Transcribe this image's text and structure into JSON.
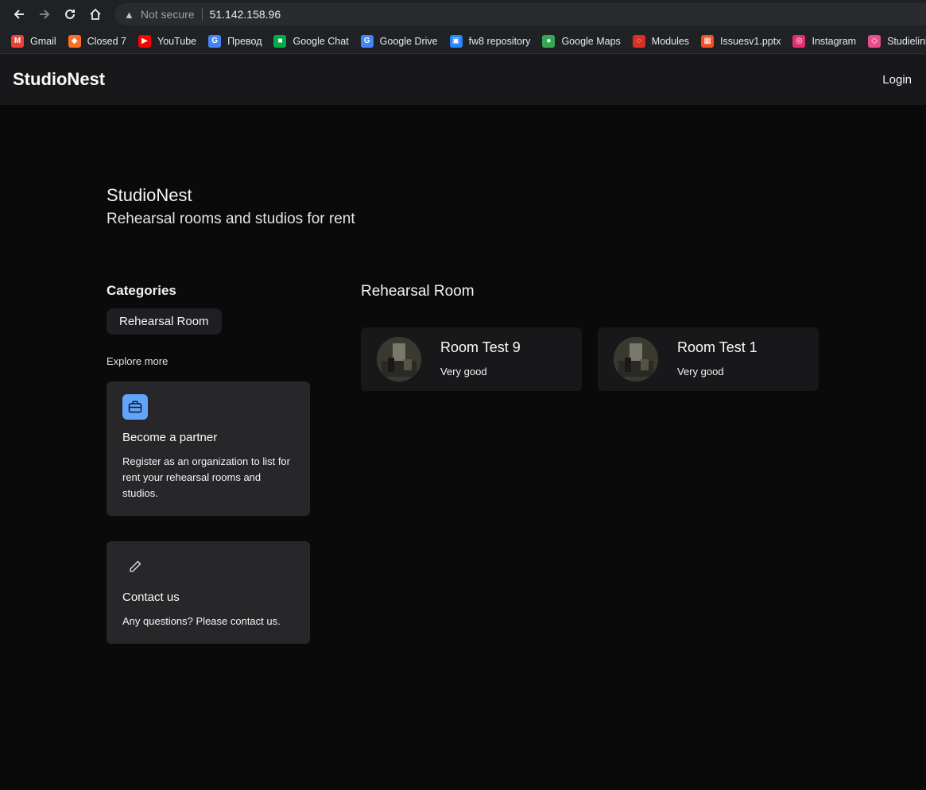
{
  "browser": {
    "not_secure": "Not secure",
    "url": "51.142.158.96",
    "bookmarks": [
      {
        "label": "Gmail",
        "icon": "gmail-icon",
        "color": "#ea4335"
      },
      {
        "label": "Closed 7",
        "icon": "gitlab-icon",
        "color": "#fc6d26"
      },
      {
        "label": "YouTube",
        "icon": "youtube-icon",
        "color": "#ff0000"
      },
      {
        "label": "Превод",
        "icon": "translate-icon",
        "color": "#4285f4"
      },
      {
        "label": "Google Chat",
        "icon": "chat-icon",
        "color": "#00ac47"
      },
      {
        "label": "Google Drive",
        "icon": "google-icon",
        "color": "#4285f4"
      },
      {
        "label": "fw8 repository",
        "icon": "bitbucket-icon",
        "color": "#2684ff"
      },
      {
        "label": "Google Maps",
        "icon": "maps-icon",
        "color": "#34a853"
      },
      {
        "label": "Modules",
        "icon": "modules-icon",
        "color": "#d93025"
      },
      {
        "label": "Issuesv1.pptx",
        "icon": "microsoft-icon",
        "color": "#f25022"
      },
      {
        "label": "Instagram",
        "icon": "instagram-icon",
        "color": "#e1306c"
      },
      {
        "label": "Studielink",
        "icon": "studielink-icon",
        "color": "#e84e8a"
      }
    ]
  },
  "header": {
    "brand": "StudioNest",
    "login": "Login"
  },
  "hero": {
    "title": "StudioNest",
    "subtitle": "Rehearsal rooms and studios for rent"
  },
  "sidebar": {
    "categories_title": "Categories",
    "categories": [
      "Rehearsal Room"
    ],
    "explore_more": "Explore more",
    "cards": [
      {
        "icon": "briefcase-icon",
        "title": "Become a partner",
        "description": "Register as an organization to list for rent your rehearsal rooms and studios."
      },
      {
        "icon": "pencil-icon",
        "title": "Contact us",
        "description": "Any questions? Please contact us."
      }
    ]
  },
  "main": {
    "category_title": "Rehearsal Room",
    "rooms": [
      {
        "name": "Room Test 9",
        "description": "Very good"
      },
      {
        "name": "Room Test 1",
        "description": "Very good"
      }
    ]
  },
  "colors": {
    "page_bg": "#0a0a0a",
    "header_bg": "#18181b",
    "card_bg": "#27272a",
    "room_card_bg": "#18181b",
    "accent": "#60a5fa"
  }
}
